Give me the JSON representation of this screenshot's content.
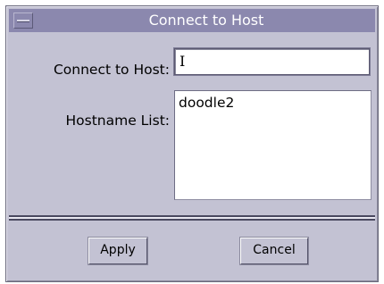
{
  "window": {
    "title": "Connect to Host"
  },
  "form": {
    "host_label": "Connect to Host:",
    "host_value": "",
    "list_label": "Hostname List:",
    "hostnames": [
      "doodle2"
    ]
  },
  "buttons": {
    "apply_label": "Apply",
    "cancel_label": "Cancel"
  },
  "icons": {
    "window_menu": "window-menu-icon",
    "text_cursor": "text-cursor-icon"
  },
  "colors": {
    "titlebar": "#8b88ae",
    "window_bg": "#c3c2d3",
    "title_text": "#ffffff"
  }
}
